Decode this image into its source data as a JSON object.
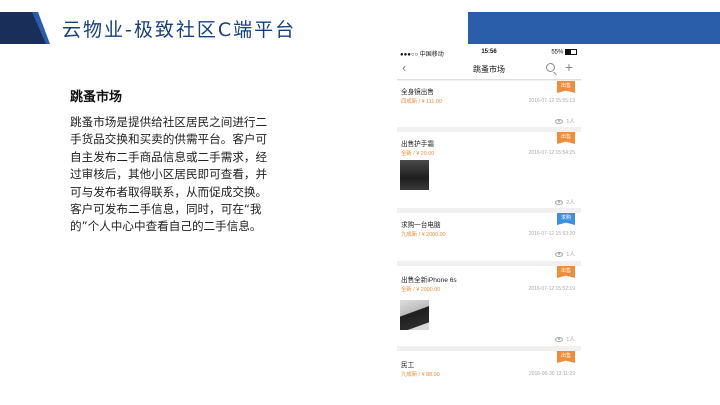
{
  "header": {
    "title": "云物业-极致社区C端平台"
  },
  "description": {
    "heading": "跳蚤市场",
    "paragraphs": [
      "跳蚤市场是提供给社区居民之间进行二手货品交换和买卖的供需平台。客户可自主发布二手商品信息或二手需求，经过审核后，其他小区居民即可查看，并可与发布者取得联系，从而促成交换。",
      "客户可发布二手信息，同时，可在“我的”个人中心中查看自己的二手信息。"
    ]
  },
  "phone": {
    "status": {
      "carrier": "●●●○○ 中国移动",
      "time": "15:56",
      "battery": "55%"
    },
    "nav": {
      "back_icon": "chevron-left-icon",
      "title": "跳蚤市场",
      "search_icon": "search-icon",
      "add_icon": "plus-icon"
    },
    "listings": [
      {
        "title": "全身镜出售",
        "price": "四成新 / ¥ 111.00",
        "date": "2016-07-12 15:55:13",
        "views": "1人",
        "tag": "出售",
        "tag_type": "sell"
      },
      {
        "title": "出售护手霜",
        "price": "全新 / ¥ 20.00",
        "date": "2016-07-12 15:54:25",
        "views": "2人",
        "tag": "出售",
        "tag_type": "sell"
      },
      {
        "title": "求购一台电脑",
        "price": "九成新 / ¥ 2000.00",
        "date": "2016-07-12 15:53:20",
        "views": "1人",
        "tag": "求购",
        "tag_type": "buy"
      },
      {
        "title": "出售全新iPhone 6s",
        "price": "全新 / ¥ 2000.00",
        "date": "2016-07-12 15:52:19",
        "views": "1人",
        "tag": "出售",
        "tag_type": "sell"
      },
      {
        "title": "民工",
        "price": "九成新 / ¥ 88.00",
        "date": "2016-06-30 13:11:29",
        "views": "",
        "tag": "出售",
        "tag_type": "sell"
      }
    ]
  },
  "colors": {
    "band": "#2a5daa",
    "band_dark": "#1a2e5a",
    "sell_tag": "#f08d3a",
    "buy_tag": "#3d8fe0"
  }
}
